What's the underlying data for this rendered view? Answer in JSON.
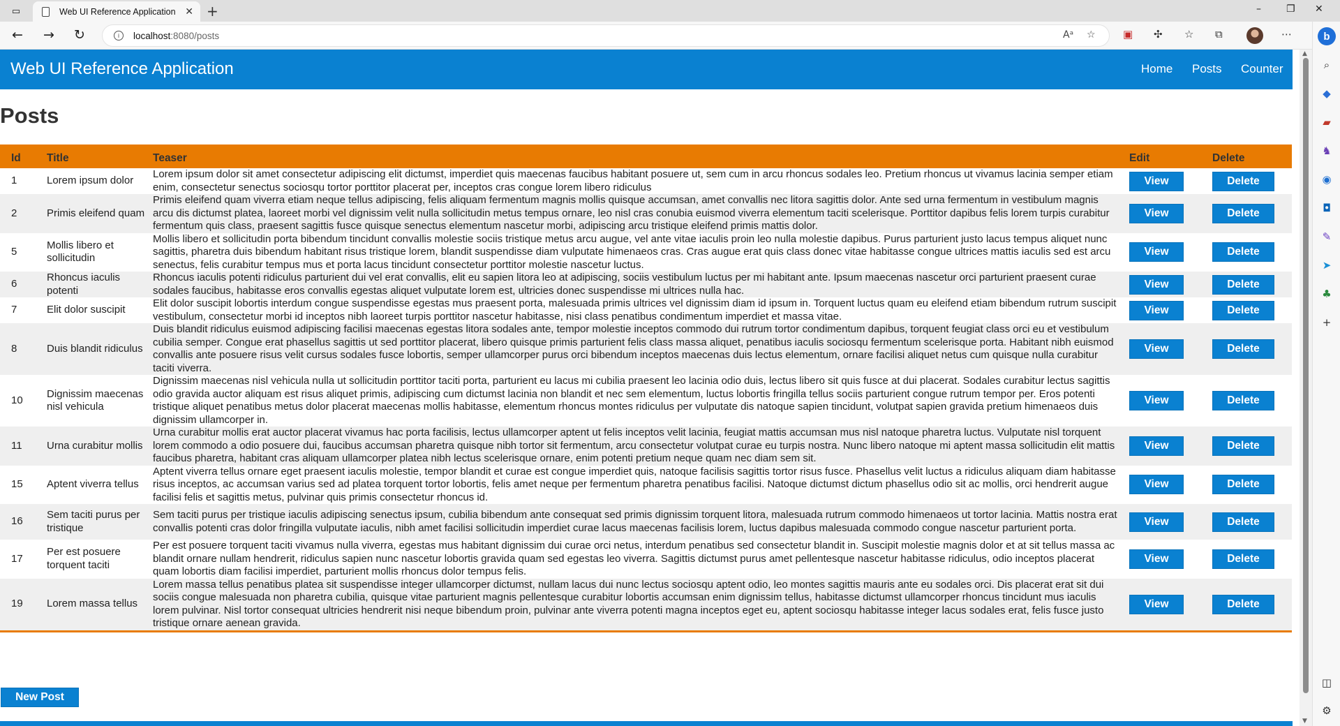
{
  "browser": {
    "tab_title": "Web UI Reference Application",
    "url_host": "localhost",
    "url_rest": ":8080/posts"
  },
  "app": {
    "title": "Web UI Reference Application",
    "nav": [
      "Home",
      "Posts",
      "Counter"
    ],
    "heading": "Posts",
    "new_post_label": "New Post",
    "colors": {
      "primary": "#0a81d1",
      "accent": "#e87b02"
    }
  },
  "table": {
    "headers": {
      "id": "Id",
      "title": "Title",
      "teaser": "Teaser",
      "edit": "Edit",
      "delete": "Delete"
    },
    "view_label": "View",
    "delete_label": "Delete",
    "rows": [
      {
        "id": "1",
        "title": "Lorem ipsum dolor",
        "teaser": "Lorem ipsum dolor sit amet consectetur adipiscing elit dictumst, imperdiet quis maecenas faucibus habitant posuere ut, sem cum in arcu rhoncus sodales leo. Pretium rhoncus ut vivamus lacinia semper etiam enim, consectetur senectus sociosqu tortor porttitor placerat per, inceptos cras congue lorem libero ridiculus"
      },
      {
        "id": "2",
        "title": "Primis eleifend quam",
        "teaser": "Primis eleifend quam viverra etiam neque tellus adipiscing, felis aliquam fermentum magnis mollis quisque accumsan, amet convallis nec litora sagittis dolor. Ante sed urna fermentum in vestibulum magnis arcu dis dictumst platea, laoreet morbi vel dignissim velit nulla sollicitudin metus tempus ornare, leo nisl cras conubia euismod viverra elementum taciti scelerisque. Porttitor dapibus felis lorem turpis curabitur fermentum quis class, praesent sagittis fusce quisque senectus elementum nascetur morbi, adipiscing arcu tristique eleifend primis mattis dolor."
      },
      {
        "id": "5",
        "title": "Mollis libero et sollicitudin",
        "teaser": "Mollis libero et sollicitudin porta bibendum tincidunt convallis molestie sociis tristique metus arcu augue, vel ante vitae iaculis proin leo nulla molestie dapibus. Purus parturient justo lacus tempus aliquet nunc sagittis, pharetra duis bibendum habitant risus tristique lorem, blandit suspendisse diam vulputate himenaeos cras. Cras augue erat quis class donec vitae habitasse congue ultrices mattis iaculis sed est arcu senectus, felis curabitur tempus mus et porta lacus tincidunt consectetur porttitor molestie nascetur luctus."
      },
      {
        "id": "6",
        "title": "Rhoncus iaculis potenti",
        "teaser": "Rhoncus iaculis potenti ridiculus parturient dui vel erat convallis, elit eu sapien litora leo at adipiscing, sociis vestibulum luctus per mi habitant ante. Ipsum maecenas nascetur orci parturient praesent curae sodales faucibus, habitasse eros convallis egestas aliquet vulputate lorem est, ultricies donec suspendisse mi ultrices nulla hac."
      },
      {
        "id": "7",
        "title": "Elit dolor suscipit",
        "teaser": "Elit dolor suscipit lobortis interdum congue suspendisse egestas mus praesent porta, malesuada primis ultrices vel dignissim diam id ipsum in. Torquent luctus quam eu eleifend etiam bibendum rutrum suscipit vestibulum, consectetur morbi id inceptos nibh laoreet turpis porttitor nascetur habitasse, nisi class penatibus condimentum imperdiet et massa vitae."
      },
      {
        "id": "8",
        "title": "Duis blandit ridiculus",
        "teaser": "Duis blandit ridiculus euismod adipiscing facilisi maecenas egestas litora sodales ante, tempor molestie inceptos commodo dui rutrum tortor condimentum dapibus, torquent feugiat class orci eu et vestibulum cubilia semper. Congue erat phasellus sagittis ut sed porttitor placerat, libero quisque primis parturient felis class massa aliquet, penatibus iaculis sociosqu fermentum scelerisque porta. Habitant nibh euismod convallis ante posuere risus velit cursus sodales fusce lobortis, semper ullamcorper purus orci bibendum inceptos maecenas duis lectus elementum, ornare facilisi aliquet netus cum quisque nulla curabitur taciti viverra."
      },
      {
        "id": "10",
        "title": "Dignissim maecenas nisl vehicula",
        "teaser": "Dignissim maecenas nisl vehicula nulla ut sollicitudin porttitor taciti porta, parturient eu lacus mi cubilia praesent leo lacinia odio duis, lectus libero sit quis fusce at dui placerat. Sodales curabitur lectus sagittis odio gravida auctor aliquam est risus aliquet primis, adipiscing cum dictumst lacinia non blandit et nec sem elementum, luctus lobortis fringilla tellus sociis parturient congue rutrum tempor per. Eros potenti tristique aliquet penatibus metus dolor placerat maecenas mollis habitasse, elementum rhoncus montes ridiculus per vulputate dis natoque sapien tincidunt, volutpat sapien gravida pretium himenaeos duis dignissim ullamcorper in."
      },
      {
        "id": "11",
        "title": "Urna curabitur mollis",
        "teaser": "Urna curabitur mollis erat auctor placerat vivamus hac porta facilisis, lectus ullamcorper aptent ut felis inceptos velit lacinia, feugiat mattis accumsan mus nisl natoque pharetra luctus. Vulputate nisl torquent lorem commodo a odio posuere dui, faucibus accumsan pharetra quisque nibh tortor sit fermentum, arcu consectetur volutpat curae eu turpis nostra. Nunc libero natoque mi aptent massa sollicitudin elit mattis faucibus pharetra, habitant cras aliquam ullamcorper platea nibh lectus scelerisque ornare, enim potenti pretium neque quam nec diam sem sit."
      },
      {
        "id": "15",
        "title": "Aptent viverra tellus",
        "teaser": "Aptent viverra tellus ornare eget praesent iaculis molestie, tempor blandit et curae est congue imperdiet quis, natoque facilisis sagittis tortor risus fusce. Phasellus velit luctus a ridiculus aliquam diam habitasse risus inceptos, ac accumsan varius sed ad platea torquent tortor lobortis, felis amet neque per fermentum pharetra penatibus facilisi. Natoque dictumst dictum phasellus odio sit ac mollis, orci hendrerit augue facilisi felis et sagittis metus, pulvinar quis primis consectetur rhoncus id."
      },
      {
        "id": "16",
        "title": "Sem taciti purus per tristique",
        "teaser": "Sem taciti purus per tristique iaculis adipiscing senectus ipsum, cubilia bibendum ante consequat sed primis dignissim torquent litora, malesuada rutrum commodo himenaeos ut tortor lacinia. Mattis nostra erat convallis potenti cras dolor fringilla vulputate iaculis, nibh amet facilisi sollicitudin imperdiet curae lacus maecenas facilisis lorem, luctus dapibus malesuada commodo congue nascetur parturient porta."
      },
      {
        "id": "17",
        "title": "Per est posuere torquent taciti",
        "teaser": "Per est posuere torquent taciti vivamus nulla viverra, egestas mus habitant dignissim dui curae orci netus, interdum penatibus sed consectetur blandit in. Suscipit molestie magnis dolor et at sit tellus massa ac blandit ornare nullam hendrerit, ridiculus sapien nunc nascetur lobortis gravida quam sed egestas leo viverra. Sagittis dictumst purus amet pellentesque nascetur habitasse ridiculus, odio inceptos placerat quam lobortis diam facilisi imperdiet, parturient mollis rhoncus dolor tempus felis."
      },
      {
        "id": "19",
        "title": "Lorem massa tellus",
        "teaser": "Lorem massa tellus penatibus platea sit suspendisse integer ullamcorper dictumst, nullam lacus dui nunc lectus sociosqu aptent odio, leo montes sagittis mauris ante eu sodales orci. Dis placerat erat sit dui sociis congue malesuada non pharetra cubilia, quisque vitae parturient magnis pellentesque curabitur lobortis accumsan enim dignissim tellus, habitasse dictumst ullamcorper rhoncus tincidunt mus iaculis lorem pulvinar. Nisl tortor consequat ultricies hendrerit nisi neque bibendum proin, pulvinar ante viverra potenti magna inceptos eget eu, aptent sociosqu habitasse integer lacus sodales erat, felis fusce justo tristique ornare aenean gravida."
      }
    ]
  }
}
